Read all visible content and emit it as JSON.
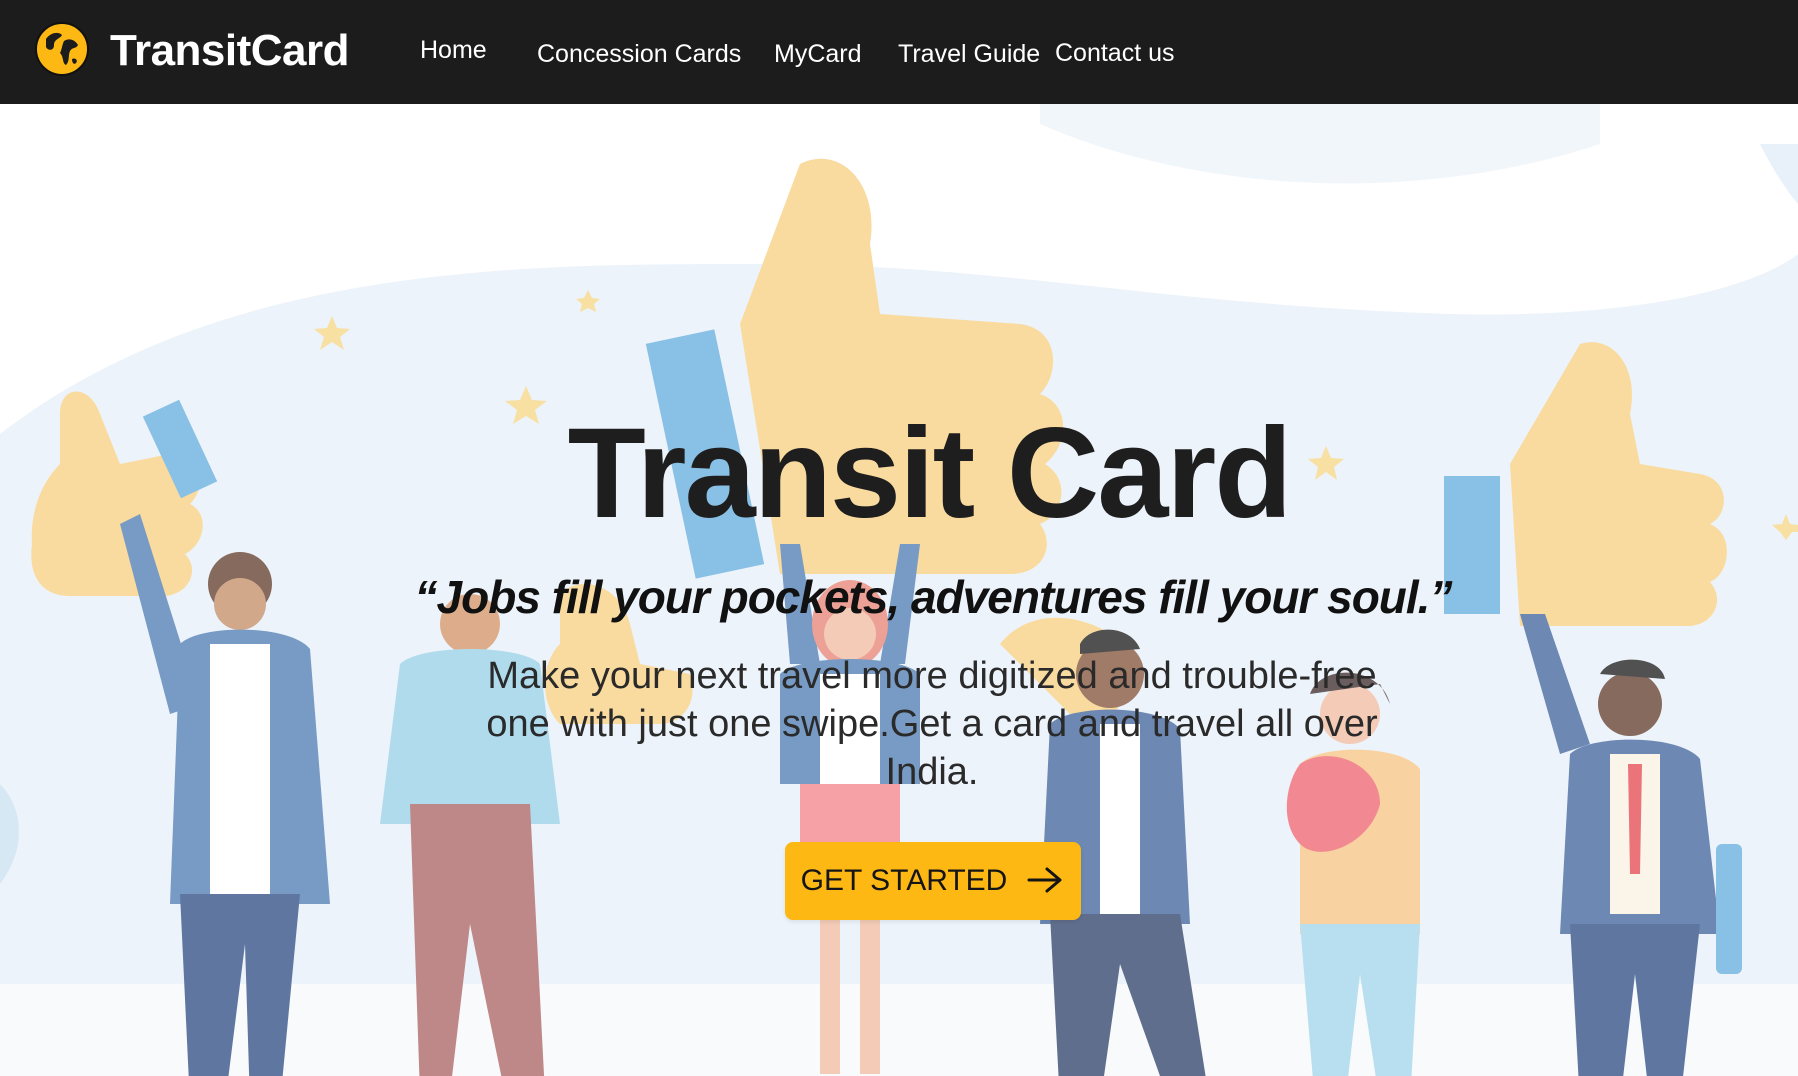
{
  "brand": {
    "name": "TransitCard",
    "logo_icon": "globe-icon",
    "logo_color": "#fdb813"
  },
  "nav": {
    "items": [
      {
        "label": "Home"
      },
      {
        "label": "Concession Cards"
      },
      {
        "label": "MyCard"
      },
      {
        "label": "Travel Guide"
      },
      {
        "label": "Contact us"
      }
    ]
  },
  "hero": {
    "title": "Transit Card",
    "quote": "“Jobs fill your pockets, adventures fill your soul.”",
    "description": "Make your next travel more digitized and trouble-free one with just one swipe.Get a card and travel all over India.",
    "cta_label": "GET STARTED",
    "cta_icon": "arrow-right-icon",
    "cta_color": "#fdb813",
    "illustration": "people-thumbs-up-illustration"
  },
  "colors": {
    "navbar_bg": "#1c1c1c",
    "accent": "#fdb813",
    "text_dark": "#1e1e1e"
  }
}
